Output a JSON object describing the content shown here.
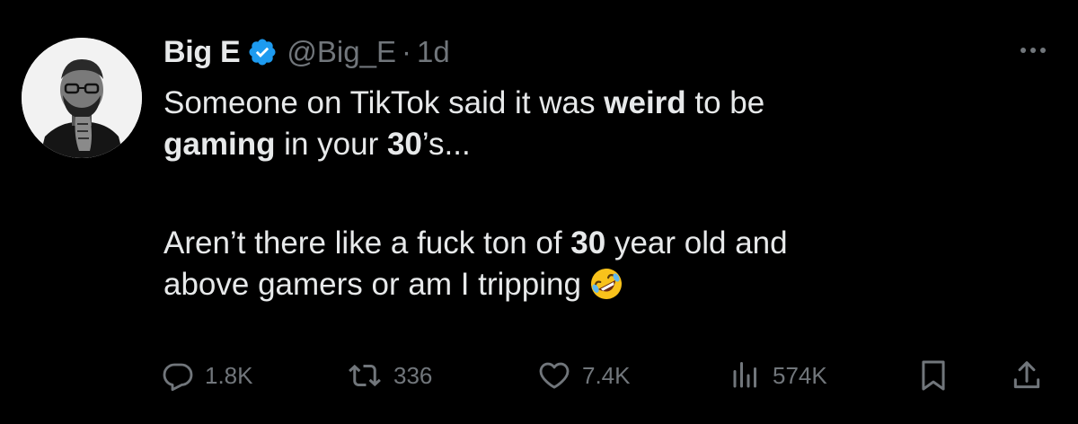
{
  "author": {
    "name": "Big E",
    "handle": "@Big_E",
    "separator": "·",
    "time": "1d",
    "verified_color": "#1d9bf0"
  },
  "tweet": {
    "line1_a": "Someone on TikTok said it was ",
    "line1_b": "weird",
    "line1_c": " to be",
    "line2_a": "gaming",
    "line2_b": " in your ",
    "line2_c": "30",
    "line2_d": "’s...",
    "line3_a": "Aren’t there like a fuck ton of ",
    "line3_b": "30",
    "line3_c": " year old and",
    "line4_a": "above gamers or am I tripping",
    "emoji": "rolling-on-the-floor-laughing"
  },
  "actions": {
    "replies": "1.8K",
    "reposts": "336",
    "likes": "7.4K",
    "views": "574K"
  },
  "icons": {
    "more": "more-dots-icon",
    "reply": "reply-icon",
    "repost": "repost-icon",
    "like": "heart-icon",
    "views": "views-icon",
    "bookmark": "bookmark-icon",
    "share": "share-icon"
  },
  "colors": {
    "background": "#000000",
    "text": "#e7e9ea",
    "muted": "#71767b"
  }
}
